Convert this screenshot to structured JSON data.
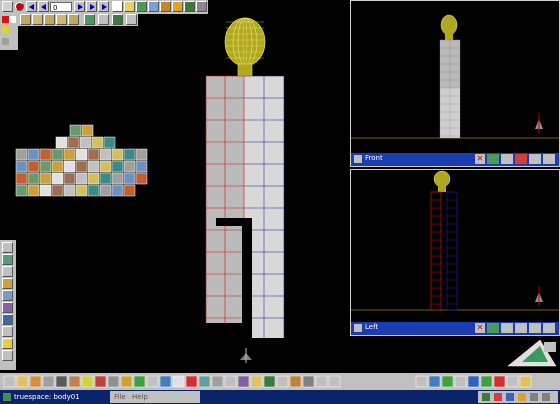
{
  "app": {
    "window_title": "truespace: body01",
    "menu": [
      "File",
      "Help"
    ]
  },
  "toolbar": {
    "frame_value": "0"
  },
  "viewports": {
    "front": {
      "label": "Front"
    },
    "left": {
      "label": "Left"
    }
  },
  "colors": {
    "background": "#000000",
    "toolbar_gray": "#c0c0c0",
    "viewport_title_bar": "#1c3cb4",
    "taskbar": "#0a246a",
    "mesh_face": "#e8e8e8",
    "wire_red": "#d01010",
    "wire_blue": "#1a1a90",
    "head_wire": "#e8e050"
  },
  "icons": {
    "palette_left": "tool-palette",
    "bottom_toolbar": "object-tools",
    "viewport_controls": "navigation-widgets"
  }
}
